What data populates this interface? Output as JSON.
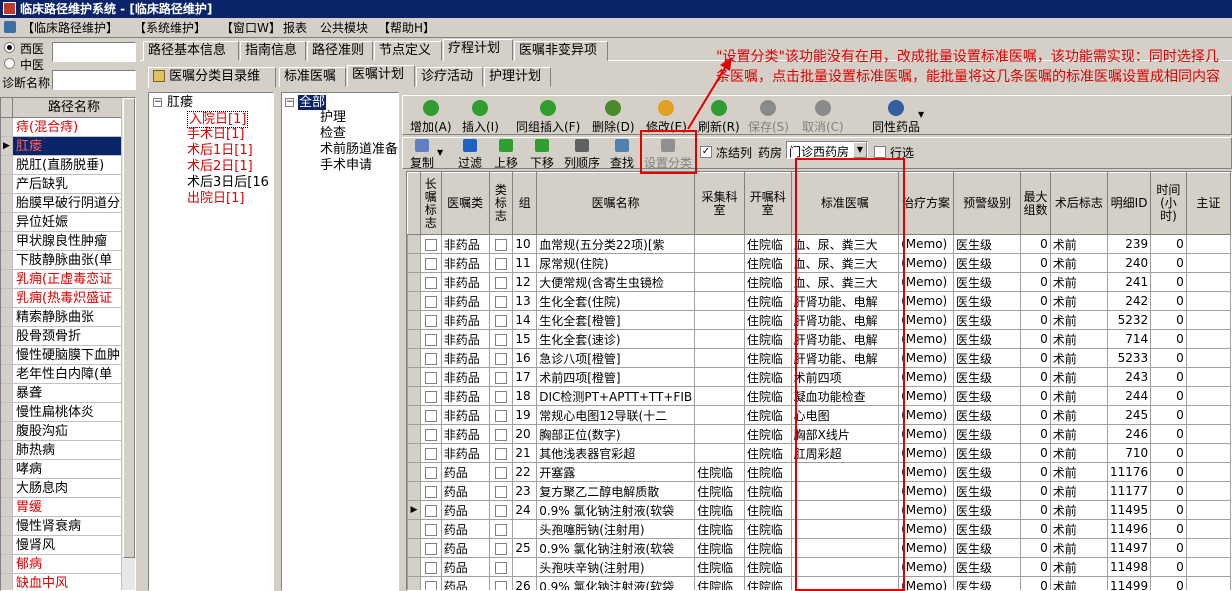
{
  "window": {
    "title": "临床路径维护系统 - [临床路径维护]"
  },
  "menu": [
    "【临床路径维护】",
    "【系统维护】",
    "【窗口W】",
    "报表",
    "公共模块",
    "【帮助H】"
  ],
  "left_panel": {
    "radio_west": "西医",
    "radio_chinese": "中医",
    "diag_label": "诊断名称",
    "header": "路径名称",
    "items": [
      {
        "label": "痔(混合痔)",
        "red": true
      },
      {
        "label": "肛瘘",
        "red": true,
        "selected": true
      },
      {
        "label": "脱肛(直肠脱垂)",
        "red": false
      },
      {
        "label": "产后缺乳",
        "red": false
      },
      {
        "label": "胎膜早破行阴道分娩",
        "red": false
      },
      {
        "label": "异位妊娠",
        "red": false
      },
      {
        "label": "甲状腺良性肿瘤",
        "red": false
      },
      {
        "label": "下肢静脉曲张(单",
        "red": false
      },
      {
        "label": "乳痈(正虚毒恋证",
        "red": true
      },
      {
        "label": "乳痈(热毒炽盛证",
        "red": true
      },
      {
        "label": "精索静脉曲张",
        "red": false
      },
      {
        "label": "股骨颈骨折",
        "red": false
      },
      {
        "label": "慢性硬脑膜下血肿",
        "red": false
      },
      {
        "label": "老年性白内障(单",
        "red": false
      },
      {
        "label": "暴聋",
        "red": false
      },
      {
        "label": "慢性扁桃体炎",
        "red": false
      },
      {
        "label": "腹股沟疝",
        "red": false
      },
      {
        "label": "肺热病",
        "red": false
      },
      {
        "label": "哮病",
        "red": false
      },
      {
        "label": "大肠息肉",
        "red": false
      },
      {
        "label": "胃缓",
        "red": true
      },
      {
        "label": "慢性肾衰病",
        "red": false
      },
      {
        "label": "慢肾风",
        "red": false
      },
      {
        "label": "郁病",
        "red": true
      },
      {
        "label": "缺血中风",
        "red": true
      }
    ]
  },
  "top_tabs": [
    "路径基本信息",
    "指南信息",
    "路径准则",
    "节点定义",
    "疗程计划",
    "医嘱非变异项"
  ],
  "sub_tab_left": "医嘱分类目录维",
  "inner_tabs": [
    "标准医嘱",
    "医嘱计划",
    "诊疗活动",
    "护理计划"
  ],
  "day_tree": {
    "root": "肛瘘",
    "children": [
      {
        "label": "入院日[1]",
        "red": true
      },
      {
        "label": "手术日[1]",
        "red": true
      },
      {
        "label": "术后1日[1]",
        "red": true
      },
      {
        "label": "术后2日[1]",
        "red": true
      },
      {
        "label": "术后3日后[16",
        "red": false
      },
      {
        "label": "出院日[1]",
        "red": true
      }
    ]
  },
  "category_tree": {
    "root": "全部",
    "children": [
      "护理",
      "检查",
      "术前肠道准备",
      "手术申请"
    ]
  },
  "toolbar1": [
    {
      "label": "增加(A)",
      "icon": "add-icon",
      "color": "#2e9e2e"
    },
    {
      "label": "插入(I)",
      "icon": "insert-icon",
      "color": "#2e9e2e"
    },
    {
      "label": "同组插入(F)",
      "icon": "group-insert-icon",
      "color": "#2e9e2e"
    },
    {
      "label": "删除(D)",
      "icon": "delete-icon",
      "color": "#4a8a2a"
    },
    {
      "label": "修改(E)",
      "icon": "edit-icon",
      "color": "#e0a020"
    },
    {
      "label": "刷新(R)",
      "icon": "refresh-icon",
      "color": "#2e9e2e"
    },
    {
      "label": "保存(S)",
      "icon": "save-icon",
      "color": "#8a8a8a"
    },
    {
      "label": "取消(C)",
      "icon": "cancel-icon",
      "color": "#8a8a8a"
    },
    {
      "label": "同性药品",
      "icon": "drug-icon",
      "color": "#3060a0"
    }
  ],
  "toolbar2": {
    "buttons": [
      {
        "label": "复制",
        "icon": "copy-icon"
      },
      {
        "label": "过滤",
        "icon": "filter-icon"
      },
      {
        "label": "上移",
        "icon": "up-arrow-icon"
      },
      {
        "label": "下移",
        "icon": "down-arrow-icon"
      },
      {
        "label": "列顺序",
        "icon": "column-order-icon"
      },
      {
        "label": "查找",
        "icon": "find-icon"
      },
      {
        "label": "设置分类",
        "icon": "set-category-icon"
      }
    ],
    "freeze_label": "冻结列",
    "pharmacy_label": "药房",
    "pharmacy_value": "门诊西药房",
    "row_select_label": "行选"
  },
  "annotation": "\"设置分类\"该功能没有在用，改成批量设置标准医嘱，该功能需实现：同时选择几条医嘱，点击批量设置标准医嘱，能批量将这几条医嘱的标准医嘱设置成相同内容",
  "grid": {
    "headers": [
      "长嘱标志",
      "医嘱类",
      "类标志",
      "组",
      "医嘱名称",
      "采集科室",
      "开嘱科室",
      "标准医嘱",
      "治疗方案",
      "预警级别",
      "最大组数",
      "术后标志",
      "明细ID",
      "时间(小时)",
      "主证"
    ],
    "rows": [
      {
        "type": "非药品",
        "group": "10",
        "name": "血常规(五分类22项)[紫",
        "collect": "",
        "dept": "住院临",
        "std": "血、尿、粪三大",
        "plan": "(Memo)",
        "warn": "医生级",
        "max": "0",
        "post": "术前",
        "id": "239",
        "time": "0",
        "current": false
      },
      {
        "type": "非药品",
        "group": "11",
        "name": "尿常规(住院)",
        "collect": "",
        "dept": "住院临",
        "std": "血、尿、粪三大",
        "plan": "(Memo)",
        "warn": "医生级",
        "max": "0",
        "post": "术前",
        "id": "240",
        "time": "0",
        "current": false
      },
      {
        "type": "非药品",
        "group": "12",
        "name": "大便常规(含寄生虫镜检",
        "collect": "",
        "dept": "住院临",
        "std": "血、尿、粪三大",
        "plan": "(Memo)",
        "warn": "医生级",
        "max": "0",
        "post": "术前",
        "id": "241",
        "time": "0",
        "current": false
      },
      {
        "type": "非药品",
        "group": "13",
        "name": "生化全套(住院)",
        "collect": "",
        "dept": "住院临",
        "std": "肝肾功能、电解",
        "plan": "(Memo)",
        "warn": "医生级",
        "max": "0",
        "post": "术前",
        "id": "242",
        "time": "0",
        "current": false
      },
      {
        "type": "非药品",
        "group": "14",
        "name": "生化全套[橙管]",
        "collect": "",
        "dept": "住院临",
        "std": "肝肾功能、电解",
        "plan": "(Memo)",
        "warn": "医生级",
        "max": "0",
        "post": "术前",
        "id": "5232",
        "time": "0",
        "current": false
      },
      {
        "type": "非药品",
        "group": "15",
        "name": "生化全套(速诊)",
        "collect": "",
        "dept": "住院临",
        "std": "肝肾功能、电解",
        "plan": "(Memo)",
        "warn": "医生级",
        "max": "0",
        "post": "术前",
        "id": "714",
        "time": "0",
        "current": false
      },
      {
        "type": "非药品",
        "group": "16",
        "name": "急诊八项[橙管]",
        "collect": "",
        "dept": "住院临",
        "std": "肝肾功能、电解",
        "plan": "(Memo)",
        "warn": "医生级",
        "max": "0",
        "post": "术前",
        "id": "5233",
        "time": "0",
        "current": false
      },
      {
        "type": "非药品",
        "group": "17",
        "name": "术前四项[橙管]",
        "collect": "",
        "dept": "住院临",
        "std": "术前四项",
        "plan": "(Memo)",
        "warn": "医生级",
        "max": "0",
        "post": "术前",
        "id": "243",
        "time": "0",
        "current": false
      },
      {
        "type": "非药品",
        "group": "18",
        "name": "DIC检测PT+APTT+TT+FIB",
        "collect": "",
        "dept": "住院临",
        "std": "凝血功能检查",
        "plan": "(Memo)",
        "warn": "医生级",
        "max": "0",
        "post": "术前",
        "id": "244",
        "time": "0",
        "current": false
      },
      {
        "type": "非药品",
        "group": "19",
        "name": "常规心电图12导联(十二",
        "collect": "",
        "dept": "住院临",
        "std": "心电图",
        "plan": "(Memo)",
        "warn": "医生级",
        "max": "0",
        "post": "术前",
        "id": "245",
        "time": "0",
        "current": false
      },
      {
        "type": "非药品",
        "group": "20",
        "name": "胸部正位(数字)",
        "collect": "",
        "dept": "住院临",
        "std": "胸部X线片",
        "plan": "(Memo)",
        "warn": "医生级",
        "max": "0",
        "post": "术前",
        "id": "246",
        "time": "0",
        "current": false
      },
      {
        "type": "非药品",
        "group": "21",
        "name": "其他浅表器官彩超",
        "collect": "",
        "dept": "住院临",
        "std": "肛周彩超",
        "plan": "(Memo)",
        "warn": "医生级",
        "max": "0",
        "post": "术前",
        "id": "710",
        "time": "0",
        "current": false
      },
      {
        "type": "药品",
        "group": "22",
        "name": "开塞露",
        "collect": "住院临",
        "dept": "住院临",
        "std": "",
        "plan": "(Memo)",
        "warn": "医生级",
        "max": "0",
        "post": "术前",
        "id": "11176",
        "time": "0",
        "current": false
      },
      {
        "type": "药品",
        "group": "23",
        "name": "复方聚乙二醇电解质散",
        "collect": "住院临",
        "dept": "住院临",
        "std": "",
        "plan": "(Memo)",
        "warn": "医生级",
        "max": "0",
        "post": "术前",
        "id": "11177",
        "time": "0",
        "current": false
      },
      {
        "type": "药品",
        "group": "24",
        "name": "0.9% 氯化钠注射液(软袋",
        "collect": "住院临",
        "dept": "住院临",
        "std": "",
        "plan": "(Memo)",
        "warn": "医生级",
        "max": "0",
        "post": "术前",
        "id": "11495",
        "time": "0",
        "current": true
      },
      {
        "type": "药品",
        "group": "",
        "name": "头孢噻肟钠(注射用)",
        "collect": "住院临",
        "dept": "住院临",
        "std": "",
        "plan": "(Memo)",
        "warn": "医生级",
        "max": "0",
        "post": "术前",
        "id": "11496",
        "time": "0",
        "current": false
      },
      {
        "type": "药品",
        "group": "25",
        "name": "0.9% 氯化钠注射液(软袋",
        "collect": "住院临",
        "dept": "住院临",
        "std": "",
        "plan": "(Memo)",
        "warn": "医生级",
        "max": "0",
        "post": "术前",
        "id": "11497",
        "time": "0",
        "current": false
      },
      {
        "type": "药品",
        "group": "",
        "name": "头孢呋辛钠(注射用)",
        "collect": "住院临",
        "dept": "住院临",
        "std": "",
        "plan": "(Memo)",
        "warn": "医生级",
        "max": "0",
        "post": "术前",
        "id": "11498",
        "time": "0",
        "current": false
      },
      {
        "type": "药品",
        "group": "26",
        "name": "0.9% 氯化钠注射液(软袋",
        "collect": "住院临",
        "dept": "住院临",
        "std": "",
        "plan": "(Memo)",
        "warn": "医生级",
        "max": "0",
        "post": "术前",
        "id": "11499",
        "time": "0",
        "current": false
      }
    ]
  },
  "colors": {
    "titlebar": "#0a246a",
    "red": "#e00000",
    "face": "#d4d0c8"
  }
}
